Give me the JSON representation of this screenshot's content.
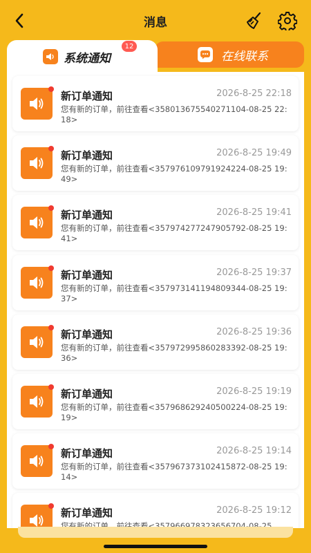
{
  "header": {
    "title": "消息"
  },
  "tabs": {
    "active_label": "系统通知",
    "active_badge": "12",
    "inactive_label": "在线联系"
  },
  "notifications": [
    {
      "title": "新订单通知",
      "time": "2026-8-25 22:18",
      "text": "您有新的订单，前往查看<358013675540271104-08-25 22:18>"
    },
    {
      "title": "新订单通知",
      "time": "2026-8-25 19:49",
      "text": "您有新的订单，前往查看<357976109791924224-08-25 19:49>"
    },
    {
      "title": "新订单通知",
      "time": "2026-8-25 19:41",
      "text": "您有新的订单，前往查看<357974277247905792-08-25 19:41>"
    },
    {
      "title": "新订单通知",
      "time": "2026-8-25 19:37",
      "text": "您有新的订单，前往查看<357973141194809344-08-25 19:37>"
    },
    {
      "title": "新订单通知",
      "time": "2026-8-25 19:36",
      "text": "您有新的订单，前往查看<357972995860283392-08-25 19:36>"
    },
    {
      "title": "新订单通知",
      "time": "2026-8-25 19:19",
      "text": "您有新的订单，前往查看<357968629240500224-08-25 19:19>"
    },
    {
      "title": "新订单通知",
      "time": "2026-8-25 19:14",
      "text": "您有新的订单，前往查看<357967373102415872-08-25 19:14>"
    },
    {
      "title": "新订单通知",
      "time": "2026-8-25 19:12",
      "text": "您有新的订单，前往查看<357966978323656704-08-25"
    }
  ],
  "colors": {
    "background": "#f5b91b",
    "accent": "#f7821d",
    "badge": "#ff5a52",
    "unread_dot": "#f03a2f"
  },
  "icons": {
    "back": "chevron-left-icon",
    "clear": "broom-icon",
    "settings": "gear-icon",
    "system_tab": "speaker-icon",
    "online_tab": "chat-bubble-icon",
    "notification": "speaker-icon"
  }
}
